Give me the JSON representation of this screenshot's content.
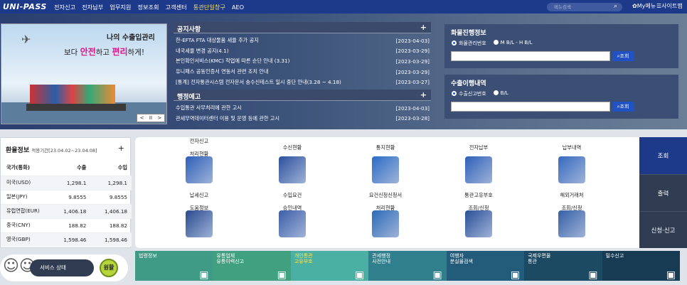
{
  "logo": "UNI-PASS",
  "nav": [
    "전자신고",
    "전자납부",
    "업무지원",
    "정보조회",
    "고객센터",
    "통관단일창구",
    "AEO"
  ],
  "search": {
    "placeholder": "메뉴검색"
  },
  "my_menu": "My메뉴",
  "sitemap": "사이트맵",
  "banner": {
    "line1": "나의 수출입관리",
    "line2a": "보다 ",
    "line2b": "안전",
    "line2c": "하고 ",
    "line2d": "편리",
    "line2e": "하게!",
    "ctrl": [
      "<",
      "II",
      ">"
    ]
  },
  "notice": {
    "title": "공지사항",
    "plus": "+",
    "items": [
      {
        "text": "한-EFTA FTA 대상물품 세율 추가 공지",
        "date": "[2023-04-03]"
      },
      {
        "text": "내국세율 변경 공지(4.1)",
        "date": "[2023-03-29]"
      },
      {
        "text": "본인확인서비스(KMC) 작업에 따른 순단 안내 (3.31)",
        "date": "[2023-03-29]"
      },
      {
        "text": "유니패스 공동인증서 연동서 관련 조치 안내",
        "date": "[2023-03-29]"
      },
      {
        "text": "[통계] 전자통관시스템 전자문서 송수신테스트 일시 중단 안내(3.28 ~ 4.18)",
        "date": "[2023-03-27]"
      }
    ]
  },
  "admin": {
    "title": "행정예고",
    "plus": "+",
    "items": [
      {
        "text": "수입통관 사무처리에 관한 고시",
        "date": "[2023-04-03]"
      },
      {
        "text": "관세무역데이터센터 이용 및 운영 등에 관한 고시",
        "date": "[2023-03-28]"
      }
    ]
  },
  "cargo": {
    "title": "화물진행정보",
    "opt1": "화물관리번호",
    "opt2": "M B/L - H B/L",
    "button": "조회"
  },
  "export": {
    "title": "수출이행내역",
    "opt1": "수출신고번호",
    "opt2": "B/L",
    "button": "조회"
  },
  "rate": {
    "title": "환율정보",
    "period": "적용기간[23.04.02~23.04.08]",
    "plus": "+",
    "headers": [
      "국가(통화)",
      "수출",
      "수입"
    ],
    "rows": [
      [
        "미국(USD)",
        "1,298.1",
        "1,298.1"
      ],
      [
        "일본(JPY)",
        "9.8555",
        "9.8555"
      ],
      [
        "유럽연합(EUR)",
        "1,406.18",
        "1,406.18"
      ],
      [
        "중국(CNY)",
        "188.82",
        "188.82"
      ],
      [
        "영국(GBP)",
        "1,598.46",
        "1,598.46"
      ]
    ]
  },
  "service": {
    "label": "서비스 상태",
    "state": "원활"
  },
  "grid": [
    {
      "l1": "전자신고",
      "l2": "처리현황",
      "icon": "bar-chart-icon",
      "color": "#2d5fb8"
    },
    {
      "l1": "수신현황",
      "l2": "",
      "icon": "monitor-mail-icon",
      "color": "#2d4f9c"
    },
    {
      "l1": "통지현황",
      "l2": "",
      "icon": "document-chart-icon",
      "color": "#2a6cc7"
    },
    {
      "l1": "전자납부",
      "l2": "",
      "icon": "printer-icon",
      "color": "#2d5fb8"
    },
    {
      "l1": "납부내역",
      "l2": "",
      "icon": "calculator-icon",
      "color": "#3569c0"
    },
    {
      "l1": "납세신고",
      "l2": "도움정보",
      "icon": "help-book-icon",
      "color": "#2a4a8e"
    },
    {
      "l1": "수입요건",
      "l2": "승인내역",
      "icon": "import-doc-icon",
      "color": "#3d5ea8"
    },
    {
      "l1": "요건신청신청서",
      "l2": "처리현황",
      "icon": "pie-chart-icon",
      "color": "#2b6ab8"
    },
    {
      "l1": "통관고유부호",
      "l2": "조회/신청",
      "icon": "barcode-person-icon",
      "color": "#2a4f96"
    },
    {
      "l1": "해외거래처",
      "l2": "조회/신청",
      "icon": "magnifier-icon",
      "color": "#355fa5"
    }
  ],
  "tabs": [
    "조회",
    "출력",
    "신청·신고"
  ],
  "quick": [
    {
      "l1": "법령정보",
      "l2": "",
      "color": "#3f9a86",
      "icon": "book-icon"
    },
    {
      "l1": "유통업체",
      "l2": "유통이력신고",
      "color": "#41a07f",
      "icon": "pencil-icon"
    },
    {
      "l1": "개인통관",
      "l2": "고유부호",
      "color": "#4bb0a4",
      "icon": "barcode-icon"
    },
    {
      "l1": "관세행정",
      "l2": "사전안내",
      "color": "#2f7f8c",
      "icon": "person-icon"
    },
    {
      "l1": "여행자",
      "l2": "분실물검색",
      "color": "#235c7a",
      "icon": "suitcase-icon"
    },
    {
      "l1": "국제우편물",
      "l2": "통관",
      "color": "#1d4a63",
      "icon": "cart-icon"
    },
    {
      "l1": "밀수신고",
      "l2": "",
      "color": "#163b52",
      "icon": "phone-24h-icon"
    }
  ]
}
